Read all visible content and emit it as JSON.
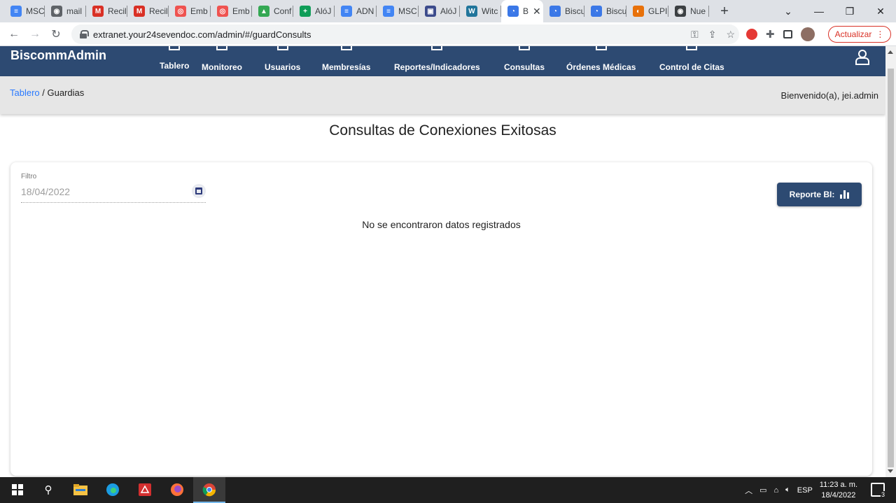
{
  "browser": {
    "tabs": [
      {
        "label": "MSC",
        "fav_color": "#4285f4",
        "glyph": "≡"
      },
      {
        "label": "mail",
        "fav_color": "#5f6368",
        "glyph": "◉"
      },
      {
        "label": "Recil",
        "fav_color": "#d93025",
        "glyph": "M"
      },
      {
        "label": "Recil",
        "fav_color": "#d93025",
        "glyph": "M"
      },
      {
        "label": "Emb",
        "fav_color": "#ef5350",
        "glyph": "◎"
      },
      {
        "label": "Emb",
        "fav_color": "#ef5350",
        "glyph": "◎"
      },
      {
        "label": "Conf",
        "fav_color": "#34a853",
        "glyph": "▲"
      },
      {
        "label": "AlóJ",
        "fav_color": "#0f9d58",
        "glyph": "+"
      },
      {
        "label": "ADN",
        "fav_color": "#4285f4",
        "glyph": "≡"
      },
      {
        "label": "MSC",
        "fav_color": "#4285f4",
        "glyph": "≡"
      },
      {
        "label": "AlóJ",
        "fav_color": "#3c4b8c",
        "glyph": "▣"
      },
      {
        "label": "Witc",
        "fav_color": "#21759b",
        "glyph": "W"
      },
      {
        "label": "B",
        "fav_color": "#3b78e7",
        "glyph": "◔",
        "active": true
      },
      {
        "label": "Biscu",
        "fav_color": "#3b78e7",
        "glyph": "◔"
      },
      {
        "label": "Biscu",
        "fav_color": "#3b78e7",
        "glyph": "◔"
      },
      {
        "label": "GLPI",
        "fav_color": "#e8710a",
        "glyph": "◐"
      },
      {
        "label": "Nue",
        "fav_color": "#3c4043",
        "glyph": "◉"
      }
    ],
    "url": "extranet.your24sevendoc.com/admin/#/guardConsults",
    "update_label": "Actualizar"
  },
  "app": {
    "brand": "BiscommAdmin",
    "nav": [
      {
        "label": "Tablero"
      },
      {
        "label": "Monitoreo"
      },
      {
        "label": "Usuarios"
      },
      {
        "label": "Membresías"
      },
      {
        "label": "Reportes/Indicadores"
      },
      {
        "label": "Consultas"
      },
      {
        "label": "Órdenes Médicas"
      },
      {
        "label": "Control de Citas"
      }
    ],
    "breadcrumb": {
      "root": "Tablero",
      "separator": " / ",
      "current": "Guardias"
    },
    "welcome": "Bienvenido(a), jei.admin",
    "page_title": "Consultas de Conexiones Exitosas",
    "filter": {
      "label": "Filtro",
      "value": "18/04/2022"
    },
    "report_button": "Reporte BI:",
    "empty_message": "No se encontraron datos registrados"
  },
  "taskbar": {
    "lang": "ESP",
    "time": "11:23 a. m.",
    "date": "18/4/2022",
    "notifications": "3"
  }
}
